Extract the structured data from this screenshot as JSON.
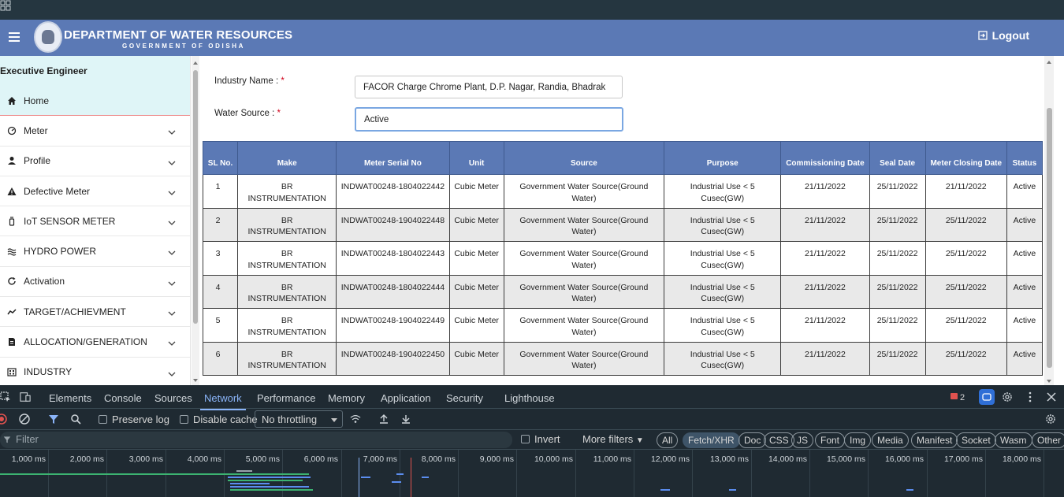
{
  "header": {
    "title": "DEPARTMENT OF WATER RESOURCES",
    "subtitle": "GOVERNMENT OF ODISHA",
    "logout_label": "Logout"
  },
  "sidebar": {
    "role": "Executive Engineer",
    "items": [
      {
        "label": "Home",
        "icon": "home-icon"
      },
      {
        "label": "Meter",
        "icon": "meter-icon"
      },
      {
        "label": "Profile",
        "icon": "person-icon"
      },
      {
        "label": "Defective Meter",
        "icon": "warning-icon"
      },
      {
        "label": "IoT SENSOR METER",
        "icon": "sensor-icon"
      },
      {
        "label": "HYDRO POWER",
        "icon": "waves-icon"
      },
      {
        "label": "Activation",
        "icon": "refresh-icon"
      },
      {
        "label": "TARGET/ACHIEVMENT",
        "icon": "trend-icon"
      },
      {
        "label": "ALLOCATION/GENERATION",
        "icon": "document-icon"
      },
      {
        "label": "INDUSTRY",
        "icon": "building-icon"
      }
    ]
  },
  "form": {
    "industry_label": "Industry Name :",
    "industry_value": "FACOR Charge Chrome Plant, D.P. Nagar, Randia, Bhadrak",
    "source_label": "Water Source :",
    "source_value": "Active",
    "required_mark": "*"
  },
  "table": {
    "headers": [
      "SL No.",
      "Make",
      "Meter Serial No",
      "Unit",
      "Source",
      "Purpose",
      "Commissioning Date",
      "Seal Date",
      "Meter Closing Date",
      "Status"
    ],
    "rows": [
      [
        "1",
        "BR INSTRUMENTATION",
        "INDWAT00248-1804022442",
        "Cubic Meter",
        "Government Water Source(Ground Water)",
        "Industrial Use < 5 Cusec(GW)",
        "21/11/2022",
        "25/11/2022",
        "21/11/2022",
        "Active"
      ],
      [
        "2",
        "BR INSTRUMENTATION",
        "INDWAT00248-1904022448",
        "Cubic Meter",
        "Government Water Source(Ground Water)",
        "Industrial Use < 5 Cusec(GW)",
        "21/11/2022",
        "25/11/2022",
        "25/11/2022",
        "Active"
      ],
      [
        "3",
        "BR INSTRUMENTATION",
        "INDWAT00248-1804022443",
        "Cubic Meter",
        "Government Water Source(Ground Water)",
        "Industrial Use < 5 Cusec(GW)",
        "21/11/2022",
        "25/11/2022",
        "25/11/2022",
        "Active"
      ],
      [
        "4",
        "BR INSTRUMENTATION",
        "INDWAT00248-1804022444",
        "Cubic Meter",
        "Government Water Source(Ground Water)",
        "Industrial Use < 5 Cusec(GW)",
        "21/11/2022",
        "25/11/2022",
        "25/11/2022",
        "Active"
      ],
      [
        "5",
        "BR INSTRUMENTATION",
        "INDWAT00248-1904022449",
        "Cubic Meter",
        "Government Water Source(Ground Water)",
        "Industrial Use < 5 Cusec(GW)",
        "21/11/2022",
        "25/11/2022",
        "25/11/2022",
        "Active"
      ],
      [
        "6",
        "BR INSTRUMENTATION",
        "INDWAT00248-1904022450",
        "Cubic Meter",
        "Government Water Source(Ground Water)",
        "Industrial Use < 5 Cusec(GW)",
        "21/11/2022",
        "25/11/2022",
        "25/11/2022",
        "Active"
      ]
    ]
  },
  "devtools": {
    "tabs": [
      "Elements",
      "Console",
      "Sources",
      "Network",
      "Performance",
      "Memory",
      "Application",
      "Security",
      "Lighthouse"
    ],
    "active_tab": "Network",
    "issues_count": "2",
    "preserve_log": "Preserve log",
    "disable_cache": "Disable cache",
    "throttling": "No throttling",
    "filter_placeholder": "Filter",
    "invert": "Invert",
    "more_filters": "More filters",
    "chips": [
      "All",
      "Fetch/XHR",
      "Doc",
      "CSS",
      "JS",
      "Font",
      "Img",
      "Media",
      "Manifest",
      "Socket",
      "Wasm",
      "Other"
    ],
    "selected_chip": "Fetch/XHR",
    "timeline_ticks": [
      "1,000 ms",
      "2,000 ms",
      "3,000 ms",
      "4,000 ms",
      "5,000 ms",
      "6,000 ms",
      "7,000 ms",
      "8,000 ms",
      "9,000 ms",
      "10,000 ms",
      "11,000 ms",
      "12,000 ms",
      "13,000 ms",
      "14,000 ms",
      "15,000 ms",
      "16,000 ms",
      "17,000 ms",
      "18,000 ms"
    ]
  },
  "colors": {
    "header_bg": "#5b79b5",
    "accent_link": "#8ab4f8",
    "required": "#d0021b",
    "devtools_bg": "#1f2a32"
  }
}
